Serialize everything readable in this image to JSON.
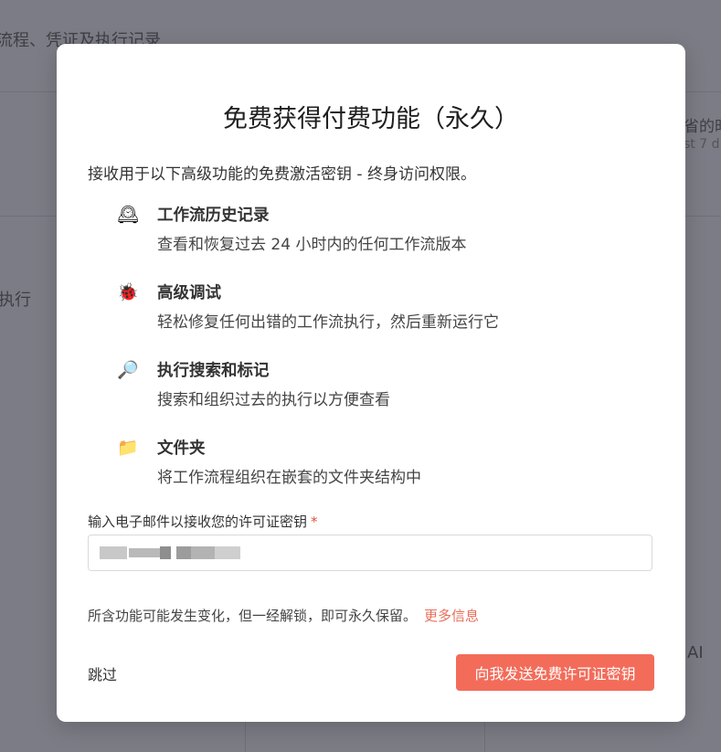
{
  "background": {
    "top_text": "流程、凭证及执行记录",
    "left_text": "执行",
    "right_top_text": "省的时",
    "right_sub_text": "st 7 d",
    "right_mid_text": "AI"
  },
  "modal": {
    "title": "免费获得付费功能（永久）",
    "subtitle": "接收用于以下高级功能的免费激活密钥 - 终身访问权限。",
    "features": [
      {
        "icon": "mantel-clock-icon",
        "glyph": "🕰",
        "title": "工作流历史记录",
        "desc": "查看和恢复过去 24 小时内的任何工作流版本"
      },
      {
        "icon": "bug-icon",
        "glyph": "🐞",
        "title": "高级调试",
        "desc": "轻松修复任何出错的工作流执行，然后重新运行它"
      },
      {
        "icon": "magnifier-icon",
        "glyph": "🔎",
        "title": "执行搜索和标记",
        "desc": "搜索和组织过去的执行以方便查看"
      },
      {
        "icon": "folder-icon",
        "glyph": "📁",
        "title": "文件夹",
        "desc": "将工作流程组织在嵌套的文件夹结构中"
      }
    ],
    "email_label": "输入电子邮件以接收您的许可证密钥",
    "required_mark": "*",
    "note": "所含功能可能发生变化，但一经解锁，即可永久保留。",
    "more_link": "更多信息",
    "skip_label": "跳过",
    "cta_label": "向我发送免费许可证密钥",
    "colors": {
      "accent": "#f36c5a",
      "link": "#e86e5a",
      "required": "#e0533c"
    }
  }
}
